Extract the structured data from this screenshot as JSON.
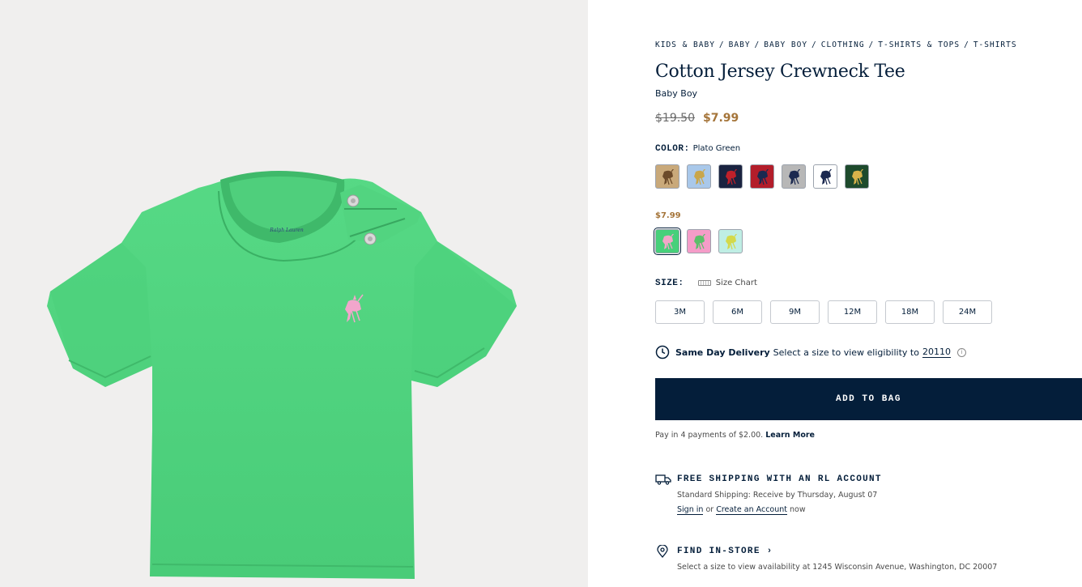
{
  "breadcrumbs": [
    "KIDS & BABY",
    "BABY",
    "BABY BOY",
    "CLOTHING",
    "T-SHIRTS & TOPS",
    "T-SHIRTS"
  ],
  "breadcrumb_separator": "/",
  "product": {
    "title": "Cotton Jersey Crewneck Tee",
    "subtitle": "Baby Boy",
    "original_price": "$19.50",
    "sale_price": "$7.99",
    "image_label": "Ralph Lauren"
  },
  "color": {
    "label": "COLOR:",
    "selected": "Plato Green",
    "full_price_swatches": [
      {
        "name": "tan-swatch",
        "bg": "#c9a97a",
        "pony": "#6b4a2a"
      },
      {
        "name": "light-blue-swatch",
        "bg": "#a9c8ea",
        "pony": "#c9a64a"
      },
      {
        "name": "navy-swatch",
        "bg": "#1a2340",
        "pony": "#c0202a"
      },
      {
        "name": "red-swatch",
        "bg": "#b31d2a",
        "pony": "#1b2950"
      },
      {
        "name": "grey-swatch",
        "bg": "#b7b7b7",
        "pony": "#1b2950"
      },
      {
        "name": "white-swatch",
        "bg": "#ffffff",
        "pony": "#1b2950"
      },
      {
        "name": "forest-green-swatch",
        "bg": "#1d4a2c",
        "pony": "#d8b24a"
      }
    ],
    "sale_label": "$7.99",
    "sale_swatches": [
      {
        "name": "plato-green-swatch",
        "bg": "#47d07a",
        "pony": "#f2a6c8",
        "selected": true
      },
      {
        "name": "pink-swatch",
        "bg": "#f59cc8",
        "pony": "#5bbf6a",
        "selected": false
      },
      {
        "name": "mint-swatch",
        "bg": "#bfeee4",
        "pony": "#d4d94a",
        "selected": false
      }
    ]
  },
  "size": {
    "label": "SIZE:",
    "chart_label": "Size Chart",
    "options": [
      "3M",
      "6M",
      "9M",
      "12M",
      "18M",
      "24M"
    ]
  },
  "delivery": {
    "title": "Same Day Delivery",
    "text": "Select a size to view eligibility to",
    "zip": "20110",
    "info": "i"
  },
  "cta": {
    "add_to_bag": "ADD TO BAG"
  },
  "payments": {
    "text": "Pay in 4 payments of $2.00.",
    "link": "Learn More"
  },
  "shipping": {
    "heading": "FREE SHIPPING WITH AN RL ACCOUNT",
    "line": "Standard Shipping: Receive by Thursday, August 07",
    "sign_in": "Sign in",
    "or": "or",
    "create": "Create an Account",
    "now": "now"
  },
  "store": {
    "heading": "FIND IN-STORE",
    "chevron": "›",
    "line": "Select a size to view availability at 1245 Wisconsin Avenue, Washington, DC 20007"
  },
  "colors": {
    "navy": "#041e3a",
    "sale": "#a5753a",
    "shirt": "#4fd47e"
  }
}
